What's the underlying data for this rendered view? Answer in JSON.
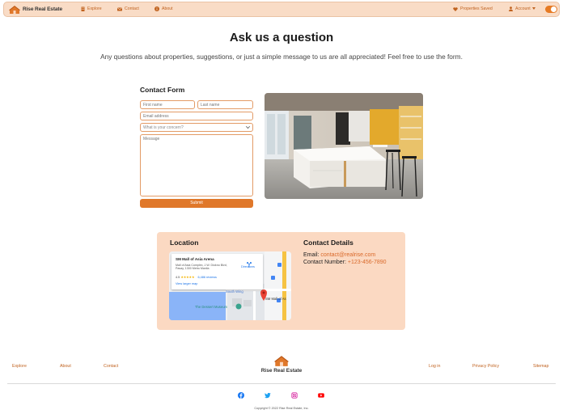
{
  "navbar": {
    "brand": "Rise Real Estate",
    "links": [
      {
        "label": "Explore",
        "icon": "building-icon"
      },
      {
        "label": "Contact",
        "icon": "mail-icon"
      },
      {
        "label": "About",
        "icon": "info-icon"
      }
    ],
    "saved": {
      "label": "Properties Saved",
      "icon": "heart-icon"
    },
    "account": {
      "label": "Account",
      "icon": "user-icon"
    },
    "theme_toggle": {
      "state": "on",
      "color": "#e67a24"
    }
  },
  "page": {
    "title": "Ask us a question",
    "subtitle": "Any questions about properties, suggestions, or just a simple message to us are all appreciated! Feel free to use the form."
  },
  "form": {
    "title": "Contact Form",
    "first_name_placeholder": "First name",
    "last_name_placeholder": "Last name",
    "email_placeholder": "Email address",
    "concern_selected": "What is your concern?",
    "message_placeholder": "Message",
    "submit_label": "Submit"
  },
  "location": {
    "title": "Location",
    "map": {
      "place_name": "SM Mall of Asia Arena",
      "address": "Mall of Asia Complex, J.W. Diokno Blvd, Pasay, 1300 Metro Manila",
      "rating": "4.5",
      "stars": "★★★★★",
      "reviews": "6,486 reviews",
      "directions": "Directions",
      "larger_map": "View larger map",
      "label_south_wing": "South Wing",
      "label_dessert_museum": "The Dessert Museum",
      "label_pin": "SM Mall of As"
    }
  },
  "contact_details": {
    "title": "Contact Details",
    "email_label": "Email:",
    "email": "contact@realrise.com",
    "phone_label": "Contact Number:",
    "phone": "+123-456-7890"
  },
  "footer": {
    "left_links": [
      "Explore",
      "About",
      "Contact"
    ],
    "brand": "Rise Real Estate",
    "right_links": [
      "Log in",
      "Privacy Policy",
      "Sitemap"
    ],
    "social": [
      "facebook-icon",
      "twitter-icon",
      "instagram-icon",
      "youtube-icon"
    ],
    "copyright": "Copyright © 2022 Rise Real Estate, Inc."
  },
  "colors": {
    "accent": "#e0782a",
    "nav_background": "#f9dcc6",
    "panel_background": "#fbd9c2",
    "link": "#c0621f"
  }
}
